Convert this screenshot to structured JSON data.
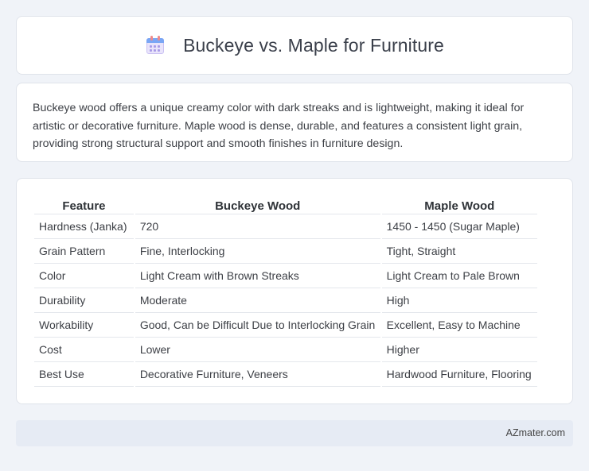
{
  "header": {
    "title": "Buckeye vs. Maple for Furniture",
    "icon": "calendar-icon"
  },
  "description": {
    "text": "Buckeye wood offers a unique creamy color with dark streaks and is lightweight, making it ideal for artistic or decorative furniture. Maple wood is dense, durable, and features a consistent light grain, providing strong structural support and smooth finishes in furniture design."
  },
  "table": {
    "headers": [
      "Feature",
      "Buckeye Wood",
      "Maple Wood"
    ],
    "rows": [
      [
        "Hardness (Janka)",
        "720",
        "1450 - 1450 (Sugar Maple)"
      ],
      [
        "Grain Pattern",
        "Fine, Interlocking",
        "Tight, Straight"
      ],
      [
        "Color",
        "Light Cream with Brown Streaks",
        "Light Cream to Pale Brown"
      ],
      [
        "Durability",
        "Moderate",
        "High"
      ],
      [
        "Workability",
        "Good, Can be Difficult Due to Interlocking Grain",
        "Excellent, Easy to Machine"
      ],
      [
        "Cost",
        "Lower",
        "Higher"
      ],
      [
        "Best Use",
        "Decorative Furniture, Veneers",
        "Hardwood Furniture, Flooring"
      ]
    ]
  },
  "footer": {
    "site": "AZmater.com"
  }
}
